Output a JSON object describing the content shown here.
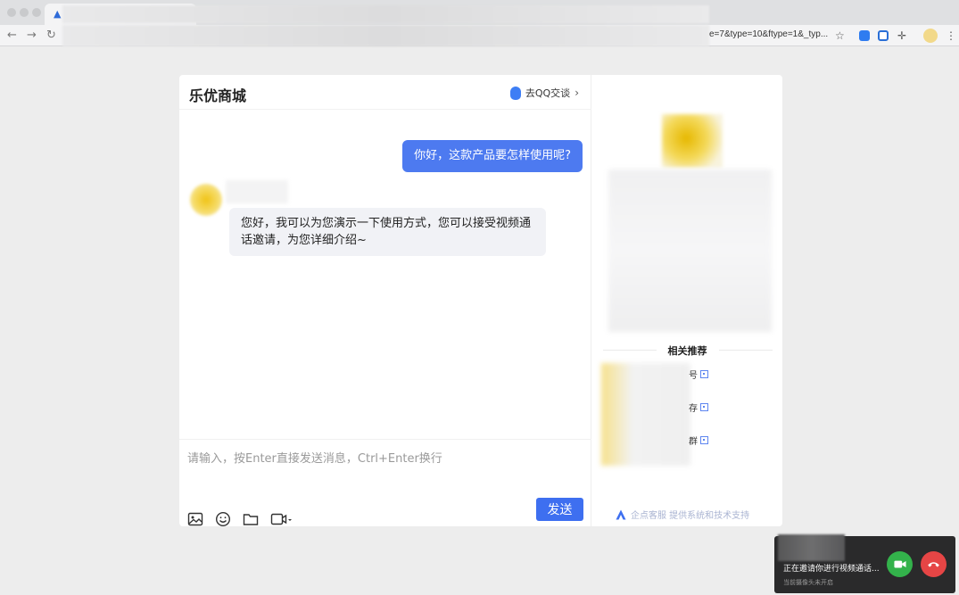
{
  "browser": {
    "url_visible": "e=7&type=10&ftype=1&_typ..."
  },
  "chat": {
    "shop_name": "乐优商城",
    "qq_link_label": "去QQ交谈",
    "messages": [
      {
        "from": "user",
        "text": "你好，这款产品要怎样使用呢?"
      },
      {
        "from": "agent",
        "text": "您好，我可以为您演示一下使用方式，您可以接受视频通话邀请，为您详细介绍~"
      }
    ],
    "input_placeholder": "请输入，按Enter直接发送消息，Ctrl+Enter换行",
    "send_label": "发送"
  },
  "side_panel": {
    "related_title": "相关推荐",
    "related_items": [
      {
        "label": "号"
      },
      {
        "label": "存"
      },
      {
        "label": "群"
      }
    ],
    "footer": "企点客服 提供系统和技术支持"
  },
  "call": {
    "inviting_text": "正在邀请你进行视频通话...",
    "camera_status": "当前摄像头未开启"
  },
  "colors": {
    "accent": "#4d7af0",
    "accept": "#33b24b",
    "decline": "#e64545"
  }
}
